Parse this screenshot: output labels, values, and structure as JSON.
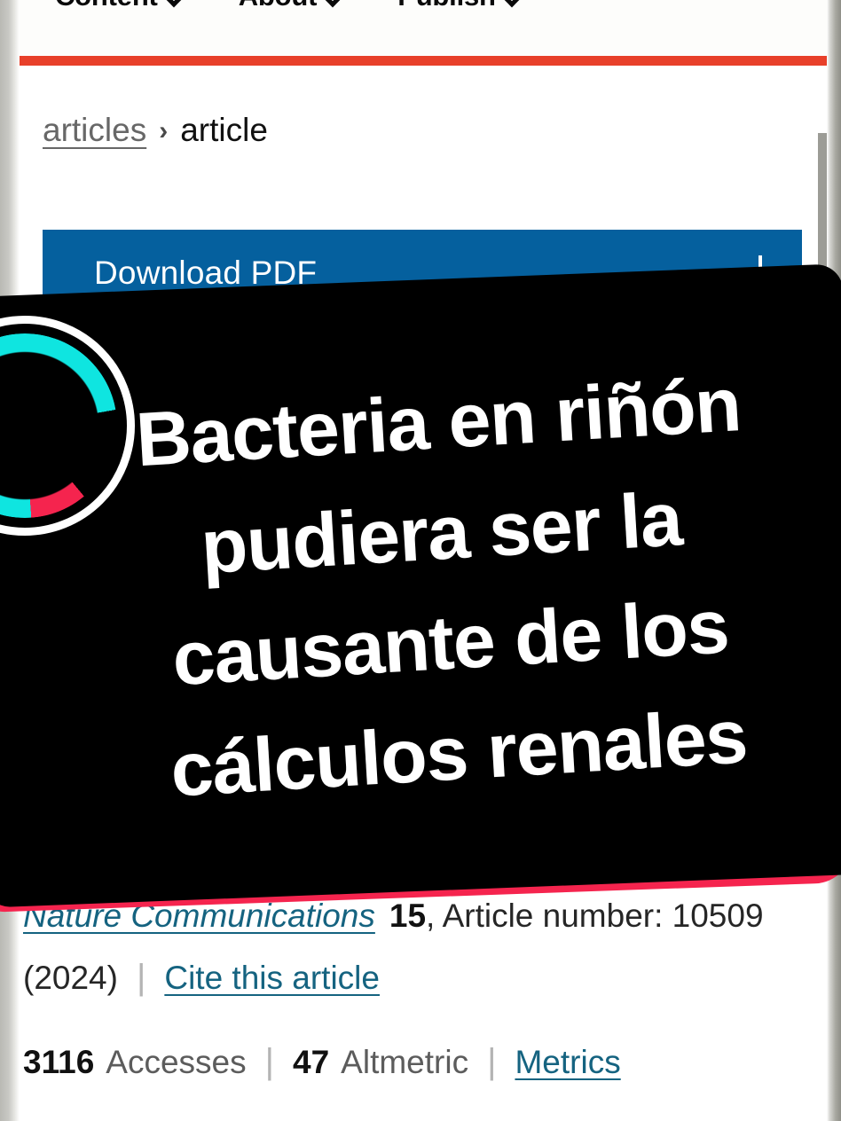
{
  "browser": {
    "nav_items": [
      {
        "label": "Content",
        "icon": "chevron-down-icon"
      },
      {
        "label": "About",
        "icon": "chevron-down-icon"
      },
      {
        "label": "Publish",
        "icon": "chevron-down-icon"
      }
    ],
    "accent_rule_color": "#e8402a"
  },
  "breadcrumb": {
    "parent": "articles",
    "separator": "›",
    "current": "article"
  },
  "actions": {
    "download_pdf_label": "Download PDF",
    "download_pdf_icon": "download-arrow-icon",
    "download_pdf_color": "#05609e"
  },
  "article_meta": {
    "journal": "Nature Communications",
    "volume": "15",
    "article_number_label": ", Article number: 10509",
    "year": "(2024)",
    "cite_link": "Cite this article",
    "accesses_count": "3116",
    "accesses_label": "Accesses",
    "altmetric_count": "47",
    "altmetric_label": "Altmetric",
    "metrics_link": "Metrics",
    "separator": "|"
  },
  "overlay": {
    "headline_lines": [
      "Bacteria en riñón",
      "pudiera ser la",
      "causante de los",
      "cálculos renales"
    ],
    "panel_color": "#000000",
    "outline_color": "#f5244e",
    "bar_color": "#0fe5e0",
    "text_color": "#ffffff",
    "donut_icon": "donut-chart-icon"
  }
}
